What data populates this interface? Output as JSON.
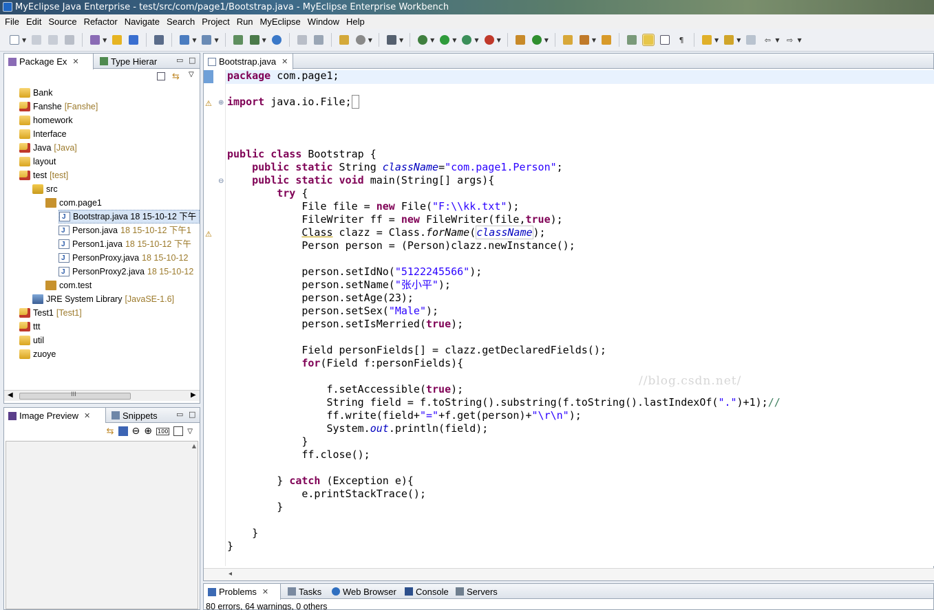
{
  "window": {
    "title": "MyEclipse Java Enterprise - test/src/com/page1/Bootstrap.java - MyEclipse Enterprise Workbench"
  },
  "menu": [
    "File",
    "Edit",
    "Source",
    "Refactor",
    "Navigate",
    "Search",
    "Project",
    "Run",
    "MyEclipse",
    "Window",
    "Help"
  ],
  "package_explorer": {
    "tabs": [
      {
        "label": "Package Ex",
        "close": "✕"
      },
      {
        "label": "Type Hierar"
      }
    ],
    "tree": [
      {
        "label": "Bank",
        "extra": "",
        "icon": "project",
        "indent": 0
      },
      {
        "label": "Fanshe",
        "extra": "[Fanshe]",
        "icon": "project-error",
        "indent": 0
      },
      {
        "label": "homework",
        "extra": "",
        "icon": "project",
        "indent": 0
      },
      {
        "label": "Interface",
        "extra": "",
        "icon": "project",
        "indent": 0
      },
      {
        "label": "Java",
        "extra": "[Java]",
        "icon": "project-error",
        "indent": 0
      },
      {
        "label": "layout",
        "extra": "",
        "icon": "project",
        "indent": 0
      },
      {
        "label": "test",
        "extra": "[test]",
        "icon": "project-error",
        "indent": 0
      },
      {
        "label": "src",
        "extra": "",
        "icon": "source-folder",
        "indent": 1
      },
      {
        "label": "com.page1",
        "extra": "",
        "icon": "package",
        "indent": 2
      },
      {
        "label": "Bootstrap.java 18  15-10-12 下午",
        "extra": "",
        "icon": "java-file",
        "indent": 3,
        "selected": true
      },
      {
        "label": "Person.java",
        "extra": "18  15-10-12 下午1",
        "icon": "java-file",
        "indent": 3
      },
      {
        "label": "Person1.java",
        "extra": "18  15-10-12 下午",
        "icon": "java-file",
        "indent": 3
      },
      {
        "label": "PersonProxy.java",
        "extra": "18  15-10-12",
        "icon": "java-file",
        "indent": 3
      },
      {
        "label": "PersonProxy2.java",
        "extra": "18  15-10-12",
        "icon": "java-file",
        "indent": 3
      },
      {
        "label": "com.test",
        "extra": "",
        "icon": "package",
        "indent": 2
      },
      {
        "label": "JRE System Library",
        "extra": "[JavaSE-1.6]",
        "icon": "library",
        "indent": 1
      },
      {
        "label": "Test1",
        "extra": "[Test1]",
        "icon": "project-error",
        "indent": 0
      },
      {
        "label": "ttt",
        "extra": "",
        "icon": "project-error",
        "indent": 0
      },
      {
        "label": "util",
        "extra": "",
        "icon": "project",
        "indent": 0
      },
      {
        "label": "zuoye",
        "extra": "",
        "icon": "project",
        "indent": 0
      }
    ],
    "scroll_mark": "III"
  },
  "image_preview": {
    "tabs": [
      {
        "label": "Image Preview",
        "close": "✕"
      },
      {
        "label": "Snippets"
      }
    ],
    "zoom_label": "100"
  },
  "editor": {
    "tab": {
      "label": "Bootstrap.java",
      "close": "✕"
    },
    "watermark": "//blog.csdn.net/"
  },
  "problems": {
    "tabs": [
      {
        "label": "Problems",
        "close": "✕"
      },
      {
        "label": "Tasks"
      },
      {
        "label": "Web Browser"
      },
      {
        "label": "Console"
      },
      {
        "label": "Servers"
      }
    ],
    "status": "80 errors, 64 warnings, 0 others"
  },
  "colors": {
    "keyword": "#7f0055",
    "string": "#2a00ff",
    "field": "#0000c0",
    "comment": "#3f7f5f"
  }
}
